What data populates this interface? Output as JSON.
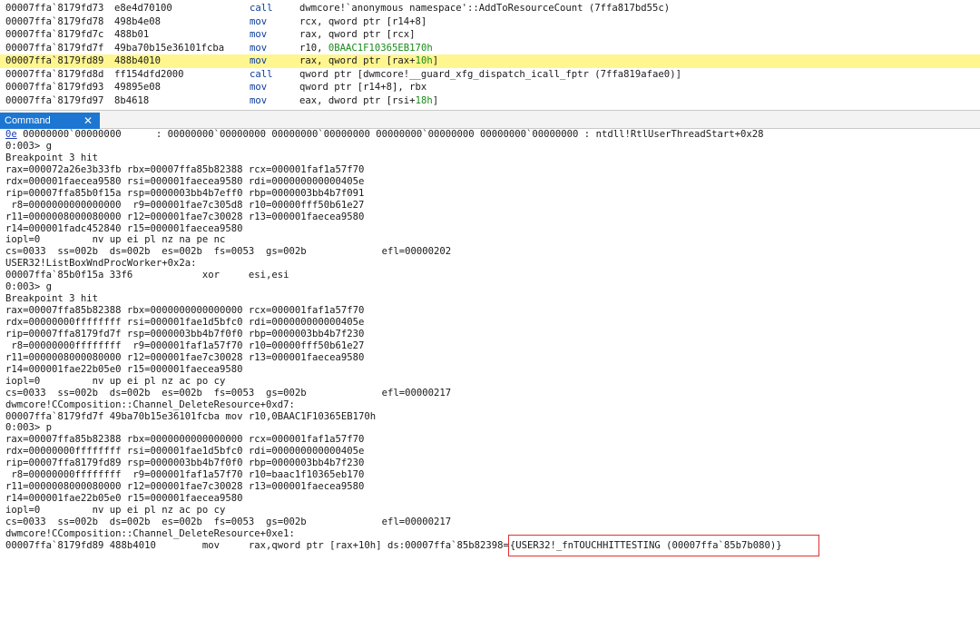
{
  "disasm": [
    {
      "addr": "00007ffa`8179fd73",
      "bytes": "e8e4d70100",
      "mnemonic": "call",
      "operand": "dwmcore!`anonymous namespace'::AddToResourceCount (7ffa817bd55c)"
    },
    {
      "addr": "00007ffa`8179fd78",
      "bytes": "498b4e08",
      "mnemonic": "mov",
      "operand": "rcx, qword ptr [r14+8]"
    },
    {
      "addr": "00007ffa`8179fd7c",
      "bytes": "488b01",
      "mnemonic": "mov",
      "operand": "rax, qword ptr [rcx]"
    },
    {
      "addr": "00007ffa`8179fd7f",
      "bytes": "49ba70b15e36101fcba",
      "mnemonic": "mov",
      "operand": "r10, ",
      "operand_green": "0BAAC1F10365EB170h"
    },
    {
      "addr": "00007ffa`8179fd89",
      "bytes": "488b4010",
      "mnemonic": "mov",
      "operand": "rax, qword ptr [rax+",
      "operand_green": "10h",
      "operand_tail": "]",
      "highlight": true
    },
    {
      "addr": "00007ffa`8179fd8d",
      "bytes": "ff154dfd2000",
      "mnemonic": "call",
      "operand": "qword ptr [dwmcore!__guard_xfg_dispatch_icall_fptr (7ffa819afae0)]"
    },
    {
      "addr": "00007ffa`8179fd93",
      "bytes": "49895e08",
      "mnemonic": "mov",
      "operand": "qword ptr [r14+8], rbx"
    },
    {
      "addr": "00007ffa`8179fd97",
      "bytes": "8b4618",
      "mnemonic": "mov",
      "operand": "eax, dword ptr [rsi+",
      "operand_green": "18h",
      "operand_tail": "]"
    }
  ],
  "tab": {
    "label": "Command",
    "close": "✕"
  },
  "command": {
    "first_link": "0e",
    "first_rest": " 00000000`00000000      : 00000000`00000000 00000000`00000000 00000000`00000000 00000000`00000000 : ntdll!RtlUserThreadStart+0x28",
    "lines": [
      "0:003> g",
      "Breakpoint 3 hit",
      "rax=000072a26e3b33fb rbx=00007ffa85b82388 rcx=000001faf1a57f70",
      "rdx=000001faecea9580 rsi=000001faecea9580 rdi=000000000000405e",
      "rip=00007ffa85b0f15a rsp=0000003bb4b7eff0 rbp=0000003bb4b7f091",
      " r8=0000000000000000  r9=000001fae7c305d8 r10=00000fff50b61e27",
      "r11=0000008000080000 r12=000001fae7c30028 r13=000001faecea9580",
      "r14=000001fadc452840 r15=000001faecea9580",
      "iopl=0         nv up ei pl nz na pe nc",
      "cs=0033  ss=002b  ds=002b  es=002b  fs=0053  gs=002b             efl=00000202",
      "USER32!ListBoxWndProcWorker+0x2a:",
      "00007ffa`85b0f15a 33f6            xor     esi,esi",
      "0:003> g",
      "Breakpoint 3 hit",
      "rax=00007ffa85b82388 rbx=0000000000000000 rcx=000001faf1a57f70",
      "rdx=00000000ffffffff rsi=000001fae1d5bfc0 rdi=000000000000405e",
      "rip=00007ffa8179fd7f rsp=0000003bb4b7f0f0 rbp=0000003bb4b7f230",
      " r8=00000000ffffffff  r9=000001faf1a57f70 r10=00000fff50b61e27",
      "r11=0000008000080000 r12=000001fae7c30028 r13=000001faecea9580",
      "r14=000001fae22b05e0 r15=000001faecea9580",
      "iopl=0         nv up ei pl nz ac po cy",
      "cs=0033  ss=002b  ds=002b  es=002b  fs=0053  gs=002b             efl=00000217",
      "dwmcore!CComposition::Channel_DeleteResource+0xd7:",
      "00007ffa`8179fd7f 49ba70b15e36101fcba mov r10,0BAAC1F10365EB170h",
      "0:003> p",
      "rax=00007ffa85b82388 rbx=0000000000000000 rcx=000001faf1a57f70",
      "rdx=00000000ffffffff rsi=000001fae1d5bfc0 rdi=000000000000405e",
      "rip=00007ffa8179fd89 rsp=0000003bb4b7f0f0 rbp=0000003bb4b7f230",
      " r8=00000000ffffffff  r9=000001faf1a57f70 r10=baac1f10365eb170",
      "r11=0000008000080000 r12=000001fae7c30028 r13=000001faecea9580",
      "r14=000001fae22b05e0 r15=000001faecea9580",
      "iopl=0         nv up ei pl nz ac po cy",
      "cs=0033  ss=002b  ds=002b  es=002b  fs=0053  gs=002b             efl=00000217",
      "dwmcore!CComposition::Channel_DeleteResource+0xe1:"
    ],
    "last_prefix": "00007ffa`8179fd89 488b4010        mov     rax,qword ptr [rax+10h] ds:00007ffa`85b82398=",
    "last_boxed": "{USER32!_fnTOUCHHITTESTING (00007ffa`85b7b080)}"
  }
}
